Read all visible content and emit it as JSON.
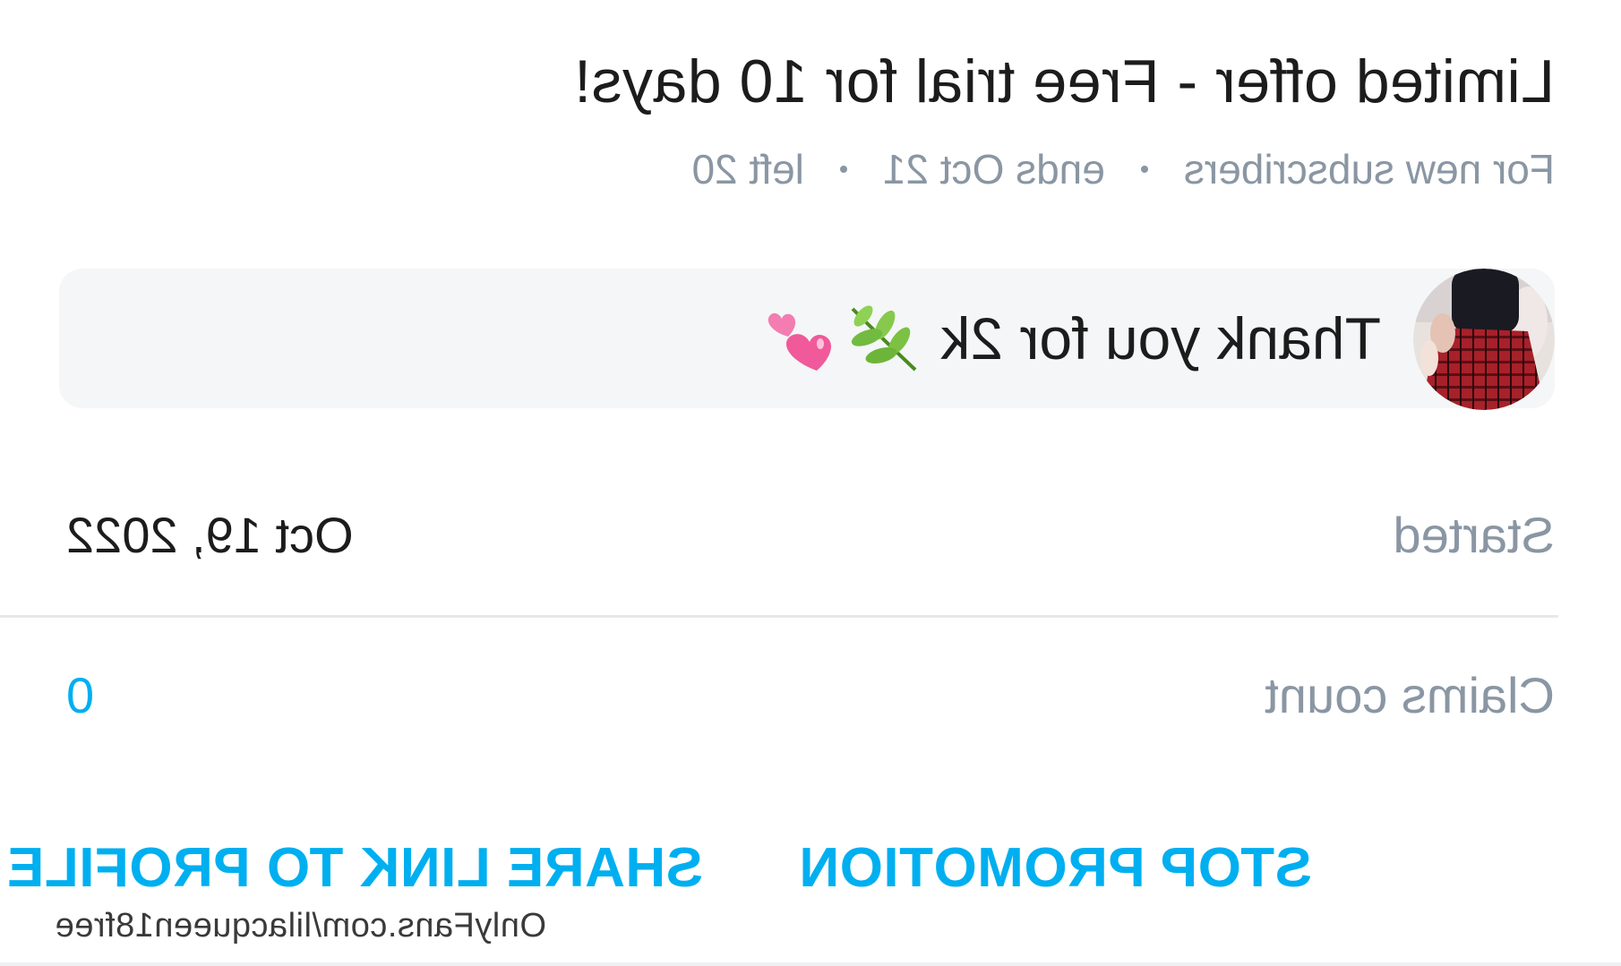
{
  "promotion": {
    "title": "Limited offer - Free trial for 10 days!",
    "meta": {
      "audience": "For new subscribers",
      "ends": "ends Oct 21",
      "left": "left 20"
    },
    "message": {
      "text": "Thank you for 2k",
      "emoji": [
        "herb-emoji",
        "two-hearts-emoji"
      ]
    }
  },
  "details": {
    "started_label": "Started",
    "started_value": "Oct 19, 2022",
    "claims_label": "Claims count",
    "claims_value": "0"
  },
  "actions": {
    "stop_label": "STOP PROMOTION",
    "share_label": "SHARE LINK TO PROFILE"
  },
  "watermark": "OnlyFans.com/lilacqueen18free",
  "colors": {
    "accent": "#00aff0",
    "muted": "#8a96a3",
    "text": "#1c1c1c",
    "bubble": "#f4f6f7"
  }
}
